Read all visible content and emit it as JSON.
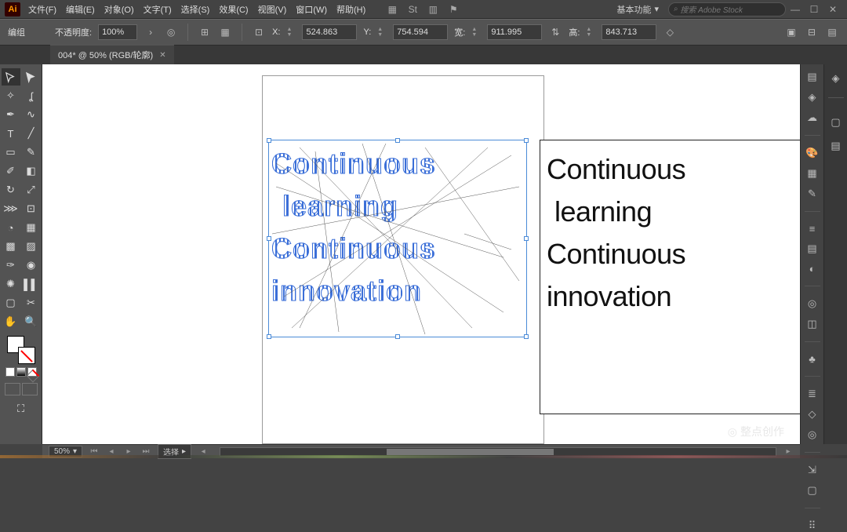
{
  "menu": {
    "items": [
      "文件(F)",
      "编辑(E)",
      "对象(O)",
      "文字(T)",
      "选择(S)",
      "效果(C)",
      "视图(V)",
      "窗口(W)",
      "帮助(H)"
    ],
    "workspace": "基本功能",
    "search_ph": "搜索 Adobe Stock"
  },
  "ctrl": {
    "mode": "编组",
    "opacity_label": "不透明度:",
    "opacity": "100%",
    "x_label": "X:",
    "x": "524.863",
    "y_label": "Y:",
    "y": "754.594",
    "w_label": "宽:",
    "w": "911.995",
    "h_label": "高:",
    "h": "843.713"
  },
  "tab": {
    "title": "004* @ 50% (RGB/轮廓)"
  },
  "canvas": {
    "line1": "Continuous",
    "line2": "learning",
    "line3": "Continuous",
    "line4": "innovation",
    "sel1": "Continuous",
    "sel2": "learning",
    "sel3": "Continuous",
    "sel4": "innovation"
  },
  "status": {
    "zoom": "50%",
    "tool": "选择"
  },
  "watermark": "整点创作"
}
